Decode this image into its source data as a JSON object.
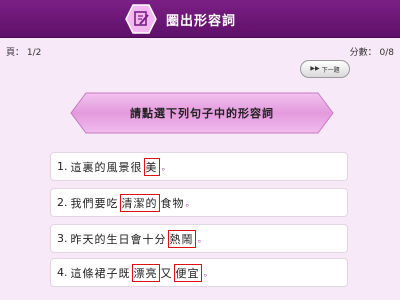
{
  "header": {
    "title": "圈出形容詞",
    "icon": "edit-icon"
  },
  "status": {
    "page_text": "頁： 1/2",
    "score_text": "分數： 0/8"
  },
  "next_button": {
    "label": "下一題",
    "icon": "fast-forward-icon"
  },
  "instruction": "請點選下列句子中的形容詞",
  "questions": [
    {
      "number": "1.",
      "before": "這裏的風景很",
      "adj1": "美",
      "middle": "",
      "adj2": "",
      "after": "",
      "end": "。"
    },
    {
      "number": "2.",
      "before": "我們要吃",
      "adj1": "清潔的",
      "middle": "",
      "adj2": "",
      "after": "食物",
      "end": "。"
    },
    {
      "number": "3.",
      "before": "昨天的生日會十分",
      "adj1": "熱鬧",
      "middle": "",
      "adj2": "",
      "after": "",
      "end": "。"
    },
    {
      "number": "4.",
      "before": "這條裙子既",
      "adj1": "漂亮",
      "middle": "又",
      "adj2": "便宜",
      "after": "",
      "end": "。"
    }
  ],
  "colors": {
    "header": "#6a1776",
    "background": "#f7e9f7",
    "banner": "#e7a2e1",
    "highlight_border": "#dd1111"
  }
}
